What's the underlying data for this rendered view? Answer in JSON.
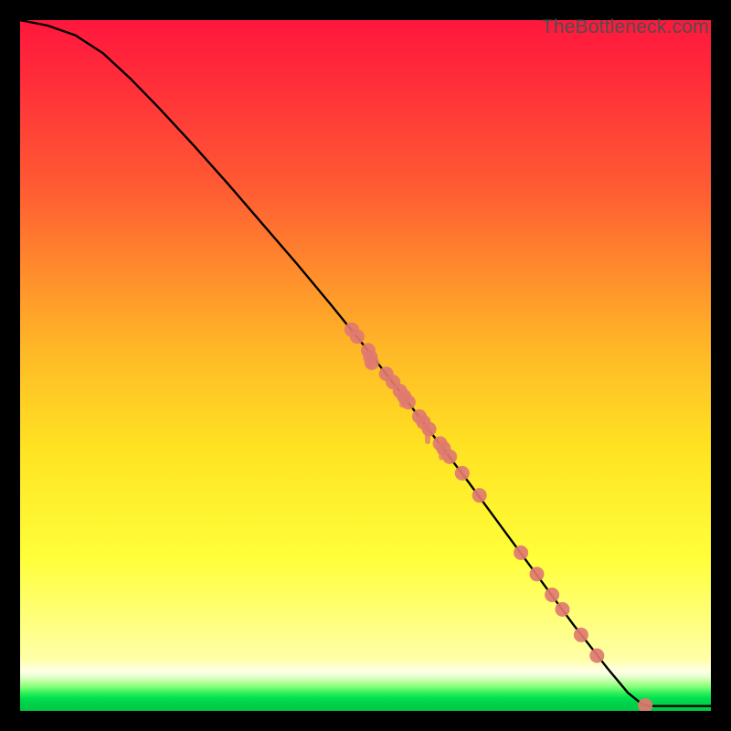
{
  "watermark": "TheBottleneck.com",
  "colors": {
    "bg": "#000000",
    "curve_stroke": "#000000",
    "point_fill": "#e07a70",
    "point_stroke": "#d05a50",
    "gradient_top": "#ff173d",
    "gradient_mid1": "#ff7a2f",
    "gradient_mid2": "#ffd820",
    "gradient_mid3": "#ffff3a",
    "gradient_bottom_yellow": "#ffffb0",
    "gradient_green1": "#d8ffb0",
    "gradient_green2": "#80ff80",
    "gradient_green3": "#00e050",
    "gradient_green4": "#00c040"
  },
  "chart_data": {
    "type": "line",
    "title": "",
    "xlabel": "",
    "ylabel": "",
    "xlim": [
      0,
      100
    ],
    "ylim": [
      0,
      100
    ],
    "curve": [
      {
        "x": 0,
        "y": 100
      },
      {
        "x": 4,
        "y": 99.2
      },
      {
        "x": 8,
        "y": 97.8
      },
      {
        "x": 12,
        "y": 95.2
      },
      {
        "x": 16,
        "y": 91.5
      },
      {
        "x": 20,
        "y": 87.4
      },
      {
        "x": 25,
        "y": 82.0
      },
      {
        "x": 30,
        "y": 76.4
      },
      {
        "x": 35,
        "y": 70.6
      },
      {
        "x": 40,
        "y": 64.8
      },
      {
        "x": 45,
        "y": 58.8
      },
      {
        "x": 50,
        "y": 52.6
      },
      {
        "x": 55,
        "y": 46.2
      },
      {
        "x": 60,
        "y": 39.6
      },
      {
        "x": 65,
        "y": 33.0
      },
      {
        "x": 70,
        "y": 26.2
      },
      {
        "x": 75,
        "y": 19.4
      },
      {
        "x": 80,
        "y": 12.6
      },
      {
        "x": 85,
        "y": 6.2
      },
      {
        "x": 88,
        "y": 2.6
      },
      {
        "x": 90,
        "y": 1.0
      },
      {
        "x": 91,
        "y": 0.7
      },
      {
        "x": 100,
        "y": 0.7
      }
    ],
    "points": [
      {
        "x": 48.0,
        "y": 55.2
      },
      {
        "x": 48.8,
        "y": 54.2
      },
      {
        "x": 50.4,
        "y": 52.2
      },
      {
        "x": 50.7,
        "y": 51.2
      },
      {
        "x": 50.9,
        "y": 50.4
      },
      {
        "x": 53.0,
        "y": 48.8
      },
      {
        "x": 54.0,
        "y": 47.6
      },
      {
        "x": 55.0,
        "y": 46.3
      },
      {
        "x": 55.6,
        "y": 45.5
      },
      {
        "x": 56.2,
        "y": 44.7
      },
      {
        "x": 57.8,
        "y": 42.6
      },
      {
        "x": 58.4,
        "y": 41.8
      },
      {
        "x": 59.2,
        "y": 40.8
      },
      {
        "x": 60.8,
        "y": 38.7
      },
      {
        "x": 61.3,
        "y": 38.0
      },
      {
        "x": 62.2,
        "y": 36.8
      },
      {
        "x": 64.0,
        "y": 34.4
      },
      {
        "x": 66.5,
        "y": 31.2
      },
      {
        "x": 72.5,
        "y": 22.9
      },
      {
        "x": 74.8,
        "y": 19.8
      },
      {
        "x": 77.0,
        "y": 16.8
      },
      {
        "x": 78.5,
        "y": 14.7
      },
      {
        "x": 81.2,
        "y": 11.0
      },
      {
        "x": 83.5,
        "y": 8.0
      },
      {
        "x": 90.5,
        "y": 0.8
      }
    ],
    "drips": [
      {
        "x": 50.6,
        "y_top": 51.8,
        "len": 2.2
      },
      {
        "x": 55.3,
        "y_top": 45.9,
        "len": 2.0
      },
      {
        "x": 59.0,
        "y_top": 41.0,
        "len": 2.4
      },
      {
        "x": 61.0,
        "y_top": 38.3,
        "len": 2.0
      }
    ]
  }
}
